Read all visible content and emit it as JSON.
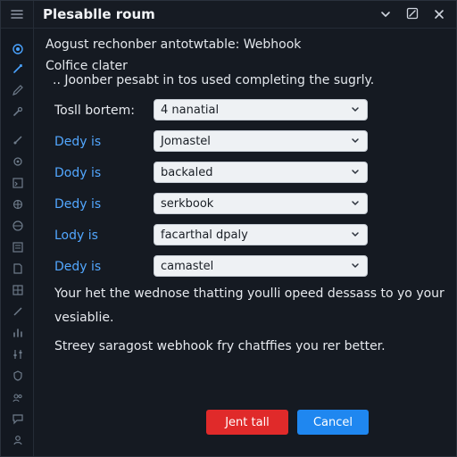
{
  "window": {
    "title": "Plesablle roum"
  },
  "titlebar": {
    "icons": [
      "menu-icon",
      "chevron-down-icon",
      "edit-icon",
      "close-icon"
    ]
  },
  "sidebar": {
    "icons": [
      "target-icon",
      "link-icon",
      "pen-icon",
      "wrench-icon",
      "brush-icon",
      "gear-icon",
      "terminal-icon",
      "settings-icon",
      "globe-icon",
      "list-icon",
      "doc-icon",
      "grid-icon",
      "slash-icon",
      "chart-icon",
      "sliders-icon",
      "shield-icon",
      "group-icon",
      "chat-icon",
      "user-icon"
    ]
  },
  "content": {
    "desc_line1": "Aogust rechonber antotwtable: Webhook",
    "desc_line2": "Colfice clater",
    "desc_line3": ".. Joonber pesabt in tos used completing the sugrly.",
    "rows": [
      {
        "label": "Tosll bortem:",
        "value": "4 nanatial",
        "label_color": "#e7eaef"
      },
      {
        "label": "Dedy is",
        "value": "Jomastel",
        "label_color": "#52a7ff"
      },
      {
        "label": "Dody is",
        "value": "backaled",
        "label_color": "#52a7ff"
      },
      {
        "label": "Dedy is",
        "value": "serkbook",
        "label_color": "#52a7ff"
      },
      {
        "label": "Lody is",
        "value": "facarthal dpaly",
        "label_color": "#52a7ff"
      },
      {
        "label": "Dedy is",
        "value": "camastel",
        "label_color": "#52a7ff"
      }
    ],
    "para_line1": "Your het the wednose thatting youlli opeed dessass to yo your",
    "para_line2": "vesiablie.",
    "para_line3": "Streey saragost webhook fry chatffies you rer better."
  },
  "footer": {
    "danger_label": "Jent tall",
    "primary_label": "Cancel"
  },
  "colors": {
    "accent": "#52a7ff",
    "danger": "#e02a2a",
    "primary": "#1f87f0",
    "background": "#151a22"
  }
}
